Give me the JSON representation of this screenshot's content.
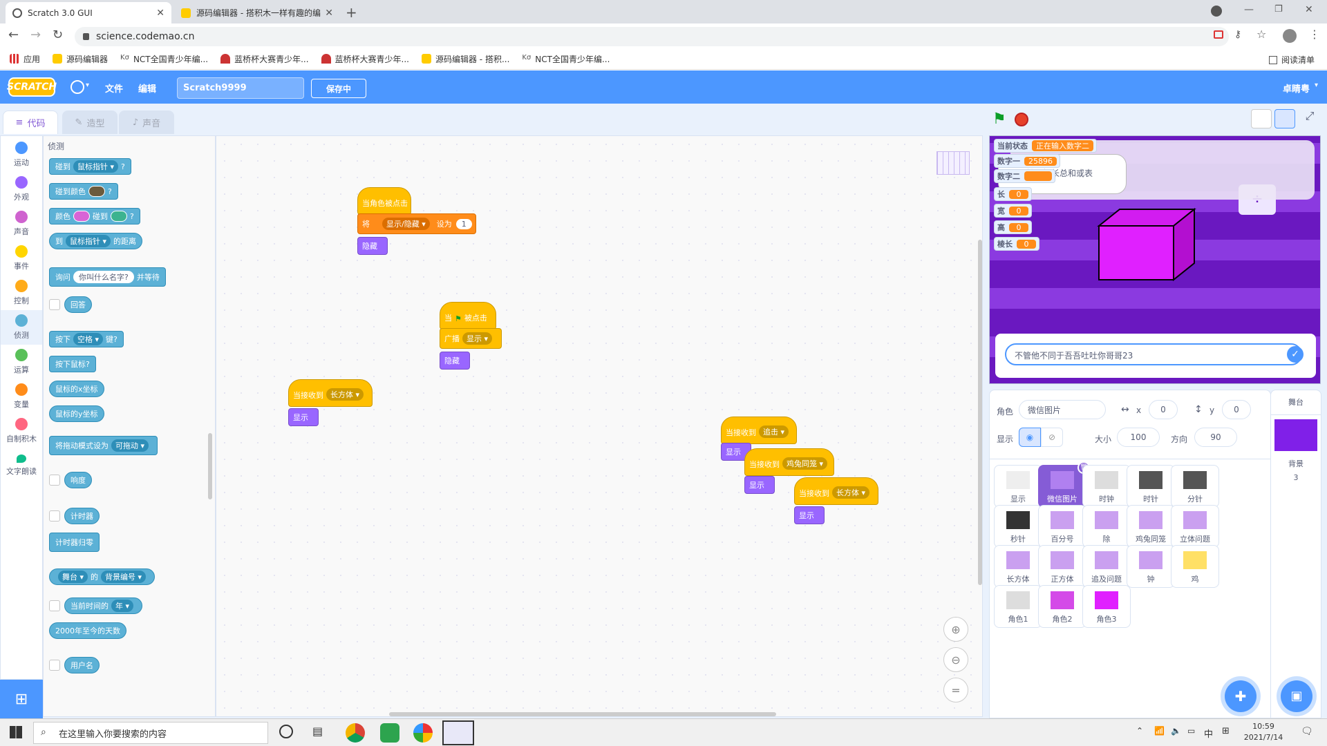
{
  "browser": {
    "tabs": [
      {
        "title": "Scratch 3.0 GUI",
        "active": true
      },
      {
        "title": "源码编辑器 - 搭积木一样有趣的编程",
        "active": false
      }
    ],
    "url": "science.codemao.cn",
    "bookmarks": [
      "应用",
      "源码编辑器",
      "NCT全国青少年编...",
      "蓝桥杯大赛青少年...",
      "蓝桥杯大赛青少年...",
      "源码编辑器 - 搭积...",
      "NCT全国青少年编..."
    ],
    "reading_list": "阅读清单"
  },
  "menubar": {
    "logo": "SCRATCH",
    "file": "文件",
    "edit": "编辑",
    "project_title": "Scratch9999",
    "save": "保存中",
    "user": "卓睛粤"
  },
  "editor_tabs": {
    "code": "代码",
    "costumes": "造型",
    "sounds": "声音"
  },
  "categories": [
    {
      "label": "运动",
      "color": "#4c97ff"
    },
    {
      "label": "外观",
      "color": "#9966ff"
    },
    {
      "label": "声音",
      "color": "#cf63cf"
    },
    {
      "label": "事件",
      "color": "#ffd500"
    },
    {
      "label": "控制",
      "color": "#ffab19"
    },
    {
      "label": "侦测",
      "color": "#5cb1d6"
    },
    {
      "label": "运算",
      "color": "#59c059"
    },
    {
      "label": "变量",
      "color": "#ff8c1a"
    },
    {
      "label": "自制积木",
      "color": "#ff6680"
    },
    {
      "label": "文字朗读",
      "color": "#0fbd8c"
    }
  ],
  "flyout": {
    "heading": "侦测",
    "touching": "碰到",
    "mouse_pointer": "鼠标指针",
    "touching_color": "碰到颜色",
    "color": "颜色",
    "touches": "碰到",
    "distance_to": "到",
    "distance_of": "的距离",
    "ask": "询问",
    "ask_default": "你叫什么名字?",
    "and_wait": "并等待",
    "answer": "回答",
    "key_press": "按下",
    "key_space": "空格",
    "key_suffix": "键?",
    "mouse_down": "按下鼠标?",
    "mouse_x": "鼠标的x坐标",
    "mouse_y": "鼠标的y坐标",
    "drag_mode": "将拖动模式设为",
    "draggable": "可拖动",
    "loudness": "响度",
    "timer": "计时器",
    "reset_timer": "计时器归零",
    "stage": "舞台",
    "of": "的",
    "backdrop_num": "背景编号",
    "current": "当前时间的",
    "year": "年",
    "days_since": "2000年至今的天数",
    "username": "用户名",
    "qmark": "?"
  },
  "scripts": {
    "s1_hat": "当角色被点击",
    "s1_set": "将",
    "s1_var": "显示/隐藏",
    "s1_to": "设为",
    "s1_val": "1",
    "s1_hide": "隐藏",
    "s2_hat_a": "当",
    "s2_hat_b": "被点击",
    "s2_broadcast": "广播",
    "s2_msg": "显示",
    "s2_hide": "隐藏",
    "s3_hat": "当接收到",
    "s3_msg": "长方体",
    "s3_show": "显示",
    "s4_hat": "当接收到",
    "s4_msg": "追击",
    "s4_show": "显示",
    "s5_hat": "当接收到",
    "s5_msg": "鸡兔同笼",
    "s5_show": "显示",
    "s6_hat": "当接收到",
    "s6_msg": "长方体",
    "s6_show": "显示"
  },
  "stage": {
    "monitors": [
      {
        "label": "当前状态",
        "value": "正在输入数字二"
      },
      {
        "label": "数字一",
        "value": "25896"
      },
      {
        "label": "数字二",
        "value": ""
      },
      {
        "label": "长",
        "value": "0"
      },
      {
        "label": "宽",
        "value": "0"
      },
      {
        "label": "高",
        "value": "0"
      },
      {
        "label": "棱长",
        "value": "0"
      }
    ],
    "speech": "输入棱长总和或表",
    "answer_text": "不管他不同于吾吾吐吐你哥哥23"
  },
  "sprite_info": {
    "sprite_label": "角色",
    "sprite_name": "微信图片",
    "x_label": "x",
    "x": "0",
    "y_label": "y",
    "y": "0",
    "show_label": "显示",
    "size_label": "大小",
    "size": "100",
    "direction_label": "方向",
    "direction": "90"
  },
  "sprites": [
    {
      "name": "显示"
    },
    {
      "name": "微信图片",
      "selected": true
    },
    {
      "name": "时钟"
    },
    {
      "name": "时针"
    },
    {
      "name": "分针"
    },
    {
      "name": "秒针"
    },
    {
      "name": "百分号"
    },
    {
      "name": "除"
    },
    {
      "name": "鸡兔同笼"
    },
    {
      "name": "立体问题"
    },
    {
      "name": "长方体"
    },
    {
      "name": "正方体"
    },
    {
      "name": "追及问题"
    },
    {
      "name": "钟"
    },
    {
      "name": "鸡"
    },
    {
      "name": "角色1"
    },
    {
      "name": "角色2"
    },
    {
      "name": "角色3"
    }
  ],
  "stage_panel": {
    "title": "舞台",
    "backdrops_label": "背景",
    "backdrop_count": "3"
  },
  "taskbar": {
    "search_placeholder": "在这里输入你要搜索的内容",
    "time": "10:59",
    "date": "2021/7/14",
    "ime": "中"
  }
}
